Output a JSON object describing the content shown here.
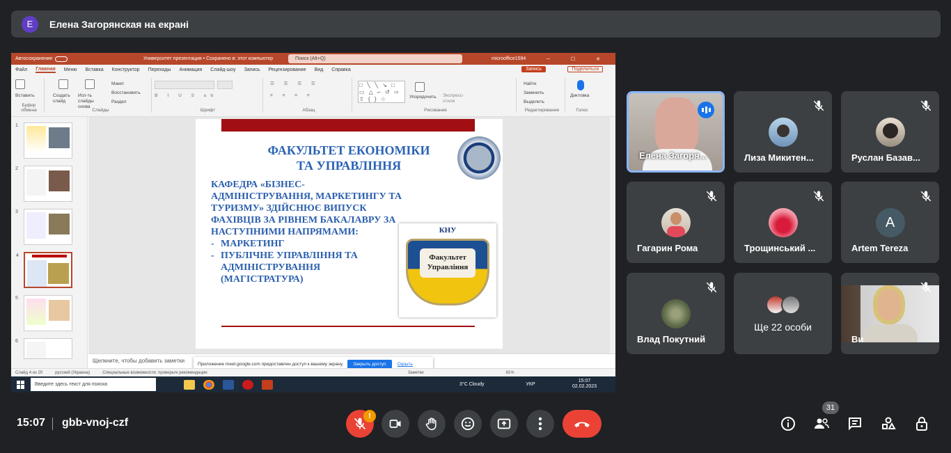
{
  "banner": {
    "avatar_letter": "E",
    "text": "Елена Загорянская на екрані"
  },
  "ppt": {
    "autosave": "Автосохранение",
    "filename": "Университет презентация • Сохранено в: этот компьютер",
    "search": "Поиск (Alt+Q)",
    "account": "microoffice1594",
    "menu": [
      "Файл",
      "Главная",
      "Меню",
      "Вставка",
      "Конструктор",
      "Переходы",
      "Анимация",
      "Слайд-шоу",
      "Запись",
      "Рецензирование",
      "Вид",
      "Справка"
    ],
    "record_label": "Запись",
    "share_label": "Поделиться",
    "ribbon_groups": [
      "Буфер обмена",
      "Слайды",
      "Шрифт",
      "Абзац",
      "Рисование",
      "Редактирование",
      "Голос"
    ],
    "ribbon_labels": {
      "paste": "Вставить",
      "new_slide": "Создать слайд",
      "reuse": "Исп-ть слайды снова",
      "layout": "Макет",
      "reset": "Восстановить",
      "section": "Раздел",
      "arrange": "Упорядочить",
      "styles": "Экспресс-стили",
      "find": "Найти",
      "replace": "Заменить",
      "select": "Выделить",
      "dictation": "Диктовка"
    },
    "slide_numbers": [
      "1",
      "2",
      "3",
      "4",
      "5",
      "6"
    ],
    "slide": {
      "title_l1": "ФАКУЛЬТЕТ ЕКОНОМІКИ",
      "title_l2": "ТА УПРАВЛІННЯ",
      "kafedra": "КАФЕДРА «БІЗНЕС-АДМІНІСТРУВАННЯ, МАРКЕТИНГУ ТА ТУРИЗМУ» ЗДІЙСНЮЄ ВИПУСК ФАХІВЦІВ ЗА РІВНЕМ БАКАЛАВРУ ЗА НАСТУПНИМИ НАПРЯМАМИ:",
      "bullet_dash": "-",
      "bullet1": "МАРКЕТИНГ",
      "bullet2": "ПУБЛІЧНЕ УПРАВЛІННЯ ТА АДМІНІСТРУВАННЯ (МАГІСТРАТУРА)",
      "logo_top": "КНУ",
      "logo_text": "Факультет Управління"
    },
    "notes_placeholder": "Щелкните, чтобы добавить заметки",
    "notify_text": "Приложение meet.google.com предоставлен доступ к вашему экрану.",
    "notify_button": "Закрыть доступ",
    "notify_link": "Скрыть",
    "status": {
      "slide": "Слайд 4 из 20",
      "lang": "русский (Украина)",
      "access": "Специальные возможности: проверьте рекомендации",
      "notes": "Заметки",
      "zoom": "81%"
    },
    "taskbar": {
      "search": "Введите здесь текст для поиска",
      "weather": "3°C Cloudy",
      "lang": "УКР",
      "time": "15:07",
      "date": "02.02.2023"
    }
  },
  "participants": [
    {
      "name": "Елена Загоря...",
      "speaking": true
    },
    {
      "name": "Лиза Микитен...",
      "muted": true
    },
    {
      "name": "Руслан Базав...",
      "muted": true
    },
    {
      "name": "Гагарин Рома",
      "muted": true
    },
    {
      "name": "Трощинський ...",
      "muted": true
    },
    {
      "name": "Artem Tereza",
      "muted": true,
      "avatar_letter": "A"
    },
    {
      "name": "Влад Покутний",
      "muted": true
    },
    {
      "name": "Ще 22 особи"
    },
    {
      "name": "Ви",
      "muted": true
    }
  ],
  "bottom": {
    "time": "15:07",
    "meeting_code": "gbb-vnoj-czf",
    "mic_warning": "!",
    "people_count": "31"
  },
  "colors": {
    "accent": "#8ab4f8",
    "end_call": "#ea4335",
    "ppt_red": "#b7472a"
  }
}
